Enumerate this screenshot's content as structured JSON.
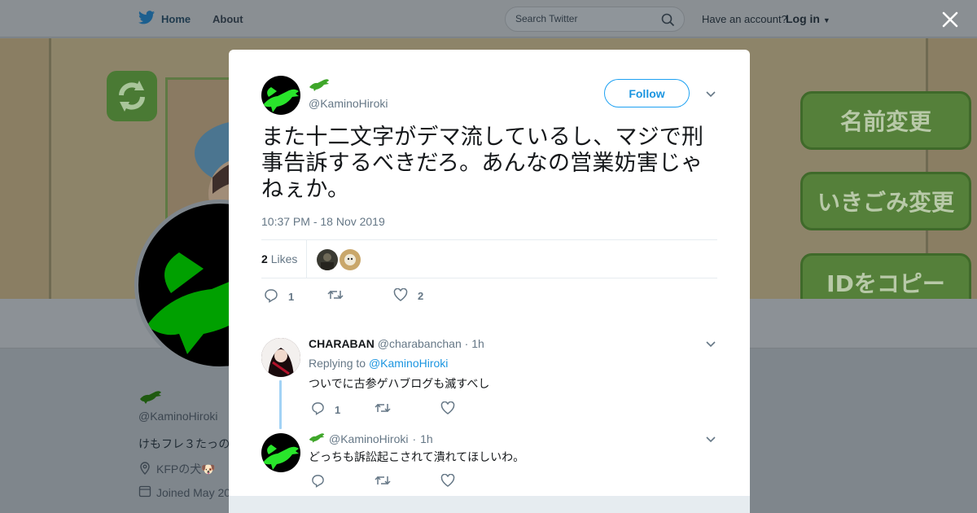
{
  "topbar": {
    "home_label": "Home",
    "about_label": "About",
    "search_placeholder": "Search Twitter",
    "have_account": "Have an account?",
    "login_label": "Log in"
  },
  "banner": {
    "buttons": [
      "名前変更",
      "いきごみ変更",
      "IDをコピー"
    ]
  },
  "profile": {
    "handle": "@KaminoHiroki",
    "bio": "けもフレ３たっの",
    "location": "KFPの犬🐶",
    "joined": "Joined May 20"
  },
  "tweet": {
    "handle": "@KaminoHiroki",
    "follow_label": "Follow",
    "text": "また十二文字がデマ流しているし、マジで刑事告訴するべきだろ。あんなの営業妨害じゃねぇか。",
    "timestamp": "10:37 PM - 18 Nov 2019",
    "likes_count": "2",
    "likes_label": "Likes",
    "reply_count": "1",
    "retweet_count": "",
    "like_count": "2"
  },
  "replies": [
    {
      "name": "CHARABAN",
      "handle": "@charabanchan",
      "separator": "·",
      "time": "1h",
      "replying_prefix": "Replying to",
      "replying_to": "@KaminoHiroki",
      "text": "ついでに古参ゲハブログも滅すべし",
      "reply_count": "1"
    },
    {
      "handle": "@KaminoHiroki",
      "separator": "·",
      "time": "1h",
      "text": "どっちも訴訟起こされて潰れてほしいわ。"
    }
  ],
  "colors": {
    "accent": "#1da1f2",
    "brand_green": "#29e52b",
    "muted_text": "#657786"
  },
  "icons": [
    "twitter-bird-icon",
    "search-icon",
    "close-icon",
    "caret-down-icon",
    "reply-icon",
    "retweet-icon",
    "heart-icon",
    "location-icon",
    "calendar-icon",
    "crocodile-icon"
  ]
}
